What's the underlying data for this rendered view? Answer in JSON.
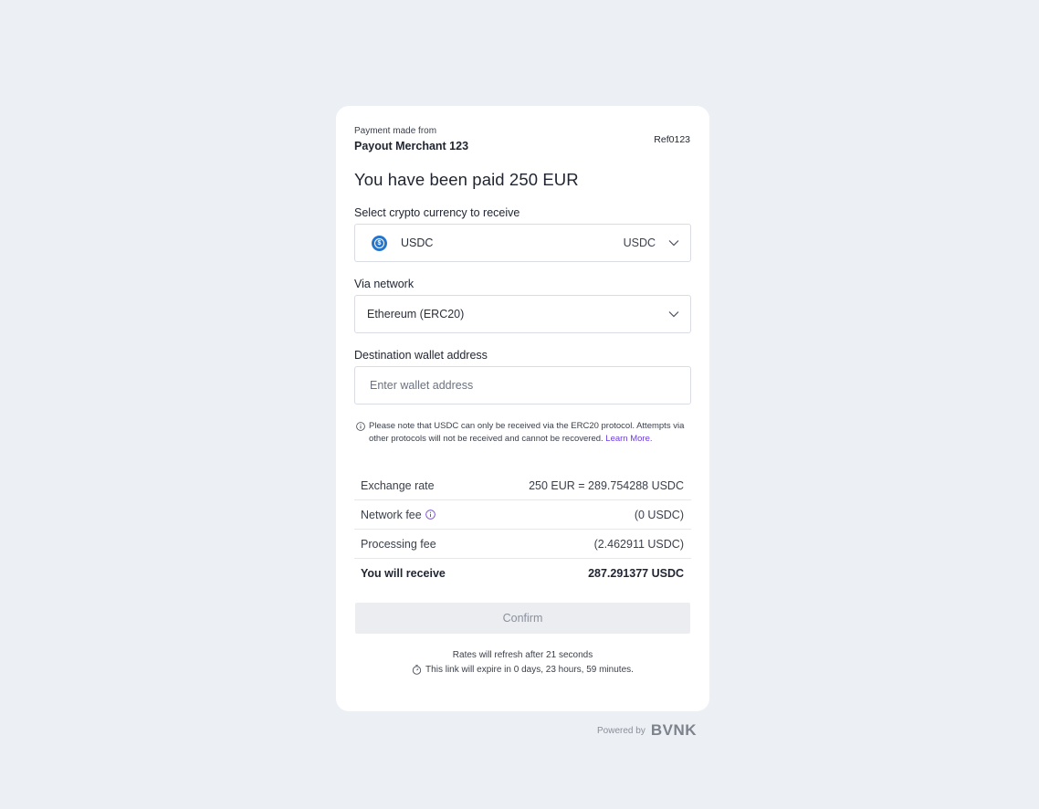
{
  "header": {
    "from_label": "Payment made from",
    "merchant": "Payout Merchant 123",
    "reference": "Ref0123"
  },
  "title": "You have been paid 250 EUR",
  "currency": {
    "label": "Select crypto currency to receive",
    "selected_name": "USDC",
    "selected_code": "USDC",
    "icon": "usdc-coin-icon",
    "icon_color": "#2775ca"
  },
  "network": {
    "label": "Via network",
    "selected": "Ethereum (ERC20)"
  },
  "wallet": {
    "label": "Destination wallet address",
    "placeholder": "Enter wallet address",
    "value": ""
  },
  "note": {
    "text": "Please note that USDC can only be received via the ERC20 protocol. Attempts via other protocols will not be received and cannot be recovered. ",
    "link": "Learn More.",
    "link_color": "#6d3ce0"
  },
  "fees": {
    "exchange_rate_label": "Exchange rate",
    "exchange_rate_value": "250 EUR = 289.754288 USDC",
    "network_fee_label": "Network fee",
    "network_fee_value": "(0 USDC)",
    "processing_fee_label": "Processing fee",
    "processing_fee_value": "(2.462911 USDC)",
    "receive_label": "You will receive",
    "receive_value": "287.291377 USDC"
  },
  "confirm_label": "Confirm",
  "refresh_text": "Rates will refresh after 21 seconds",
  "expire_text": "This link will expire in 0 days, 23 hours, 59 minutes.",
  "footer": {
    "powered_label": "Powered by",
    "brand": "BVNK"
  }
}
